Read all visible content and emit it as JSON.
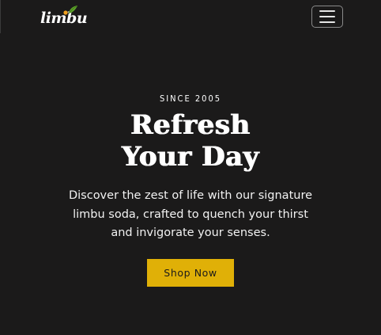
{
  "navbar": {
    "logo_text": "limbu",
    "menu_toggle_icon": "hamburger-icon"
  },
  "hero": {
    "eyebrow": "SINCE 2005",
    "headline_line1": "Refresh",
    "headline_line2": "Your Day",
    "lead_line1": "Discover the zest of life with our signature",
    "lead_line2": "limbu soda, crafted to quench your thirst",
    "lead_line3": "and invigorate your senses.",
    "cta_label": "Shop Now"
  },
  "colors": {
    "background": "#1b1a1a",
    "accent": "#e0b007",
    "leaf": "#5fa32a",
    "dot": "#f0a020"
  }
}
